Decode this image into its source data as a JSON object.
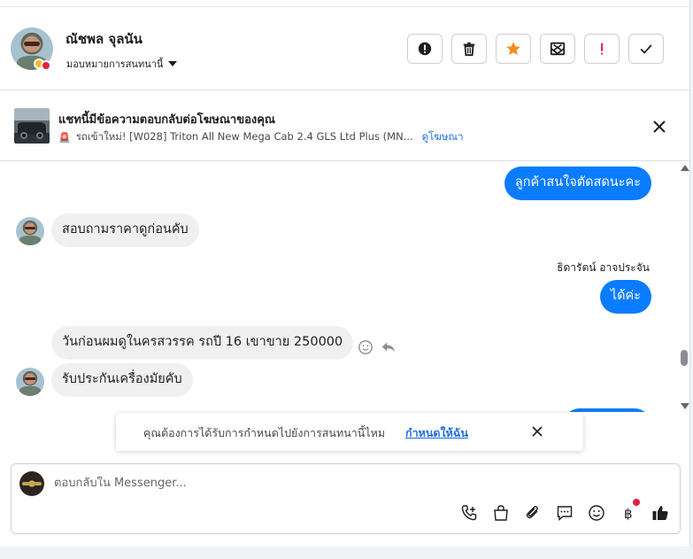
{
  "header": {
    "contact_name": "ณัชพล จุลนัน",
    "assign_label": "มอบหมายการสนทนานี้"
  },
  "ad_banner": {
    "title": "แชทนี้มีข้อความตอบกลับต่อโฆษณาของคุณ",
    "subtitle": "รถเข้าใหม่! [W028] Triton All New Mega Cab 2.4 GLS Ltd Plus (MN...",
    "view_ad_link": "ดูโฆษณา"
  },
  "messages": [
    {
      "direction": "outgoing",
      "text": "ลูกค้าสนใจตัดสดนะคะ"
    },
    {
      "direction": "incoming",
      "text": "สอบถามราคาดูก่อนคับ"
    },
    {
      "direction": "outgoing",
      "sender": "ธิดารัตน์ อาจประจัน",
      "text": "ได้ค่ะ"
    },
    {
      "direction": "incoming",
      "text": "วันก่อนผมดูในครสวรรค รถปี 16 เขาขาย 250000"
    },
    {
      "direction": "incoming",
      "text": "รับประกันเครื่องมัยคับ"
    }
  ],
  "reminder": {
    "text": "คุณต้องการได้รับการกำหนดไปยังการสนทนานี้ไหม",
    "link": "กำหนดให้ฉัน"
  },
  "reply": {
    "placeholder": "ตอบกลับใน Messenger...",
    "tools": [
      "call-icon",
      "shopping-bag-icon",
      "attachment-icon",
      "saved-reply-icon",
      "emoji-icon",
      "baht-payment-icon",
      "like-icon"
    ]
  },
  "colors": {
    "accent": "#0a7cff",
    "star_button": "#f58c1f",
    "urgent": "#e41e3f"
  }
}
